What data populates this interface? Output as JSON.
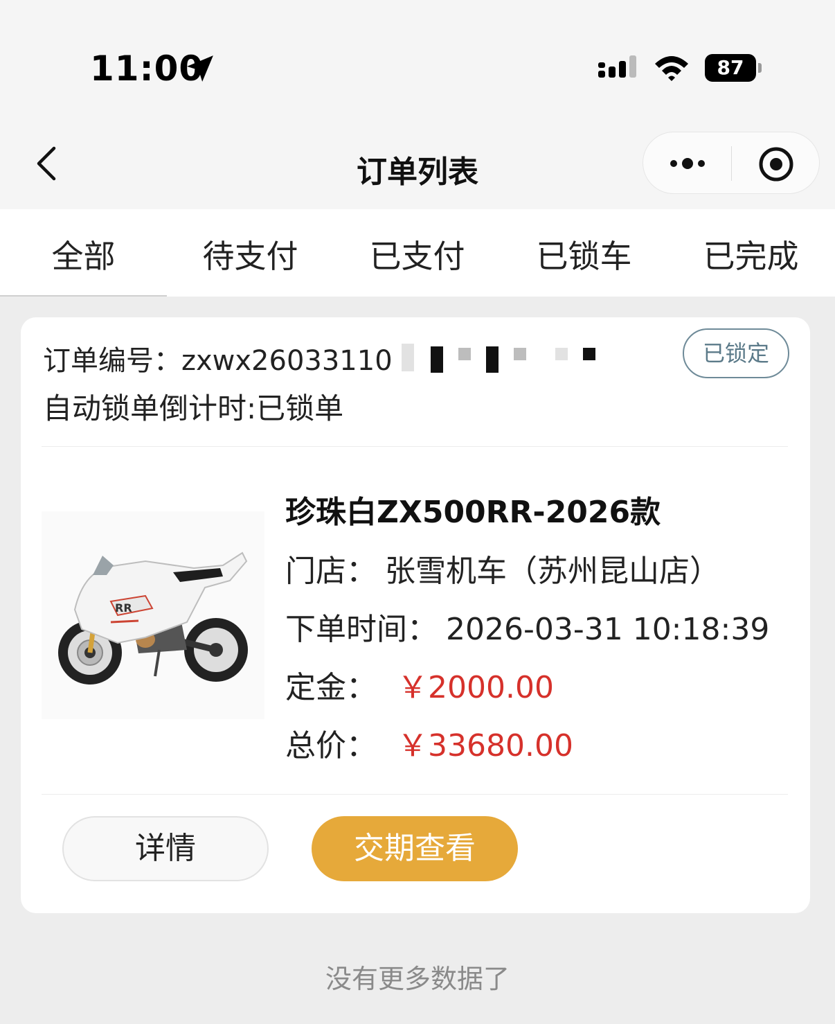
{
  "status_bar": {
    "time": "11:00",
    "battery": "87",
    "icons": [
      "location-arrow-icon",
      "cellular-signal-icon",
      "wifi-icon",
      "battery-icon"
    ]
  },
  "nav": {
    "title": "订单列表",
    "icons": [
      "back-chevron-icon",
      "more-dots-icon",
      "target-circle-icon"
    ]
  },
  "tabs": [
    {
      "label": "全部",
      "active": true
    },
    {
      "label": "待支付",
      "active": false
    },
    {
      "label": "已支付",
      "active": false
    },
    {
      "label": "已锁车",
      "active": false
    },
    {
      "label": "已完成",
      "active": false
    }
  ],
  "order": {
    "number_label": "订单编号：",
    "number_value": "zxwx26033110",
    "status_badge": "已锁定",
    "countdown_text": "自动锁单倒计时:已锁单",
    "product_name": "珍珠白ZX500RR-2026款",
    "store_label": "门店：",
    "store_value": "张雪机车（苏州昆山店）",
    "time_label": "下单时间：",
    "time_value": "2026-03-31 10:18:39",
    "deposit_label": "定金：",
    "deposit_value": "￥2000.00",
    "total_label": "总价：",
    "total_value": "￥33680.00",
    "detail_button": "详情",
    "delivery_button": "交期查看"
  },
  "footer": {
    "no_more_text": "没有更多数据了"
  },
  "colors": {
    "price_red": "#d6312b",
    "accent_orange": "#e6a93a",
    "badge_border": "#6e8a98",
    "page_bg": "#ededed"
  }
}
